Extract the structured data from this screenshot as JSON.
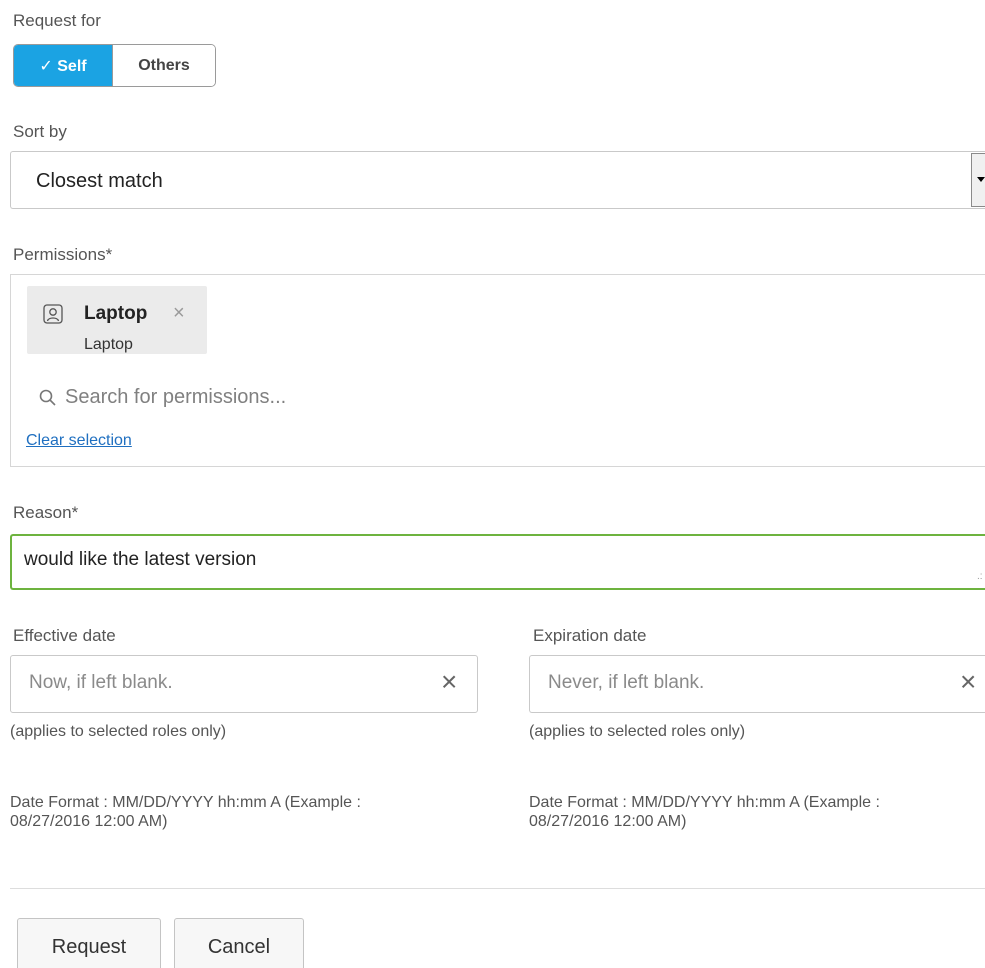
{
  "request_for": {
    "label": "Request for",
    "options": [
      "✓ Self",
      "Others"
    ],
    "selected": "✓ Self"
  },
  "sort_by": {
    "label": "Sort by",
    "value": "Closest match"
  },
  "permissions": {
    "label": "Permissions*",
    "chip": {
      "icon": "user-profile-icon",
      "title": "Laptop",
      "subtitle": "Laptop",
      "remove_symbol": "×"
    },
    "search_placeholder": "Search for permissions...",
    "clear_label": "Clear selection"
  },
  "reason": {
    "label": "Reason*",
    "value": "would like the latest version"
  },
  "effective_date": {
    "label": "Effective date",
    "placeholder": "Now, if left blank.",
    "note": "(applies to selected roles only)",
    "format_line1": "Date Format : MM/DD/YYYY hh:mm A (Example :",
    "format_line2": "08/27/2016 12:00 AM)"
  },
  "expiration_date": {
    "label": "Expiration date",
    "placeholder": "Never, if left blank.",
    "note": "(applies to selected roles only)",
    "format_line1": "Date Format : MM/DD/YYYY hh:mm A (Example :",
    "format_line2": "08/27/2016 12:00 AM)"
  },
  "clear_symbol": "×",
  "actions": {
    "request_label": "Request",
    "cancel_label": "Cancel"
  },
  "colors": {
    "accent": "#1ba3e3",
    "focus_border": "#6db33f",
    "link": "#1f6fc0"
  }
}
